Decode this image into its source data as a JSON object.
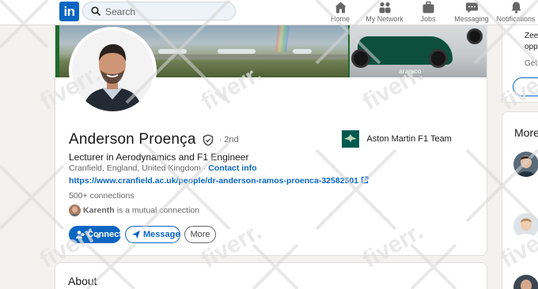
{
  "nav": {
    "logo": "in",
    "search_placeholder": "Search",
    "items": [
      {
        "label": "Home",
        "icon": "home-icon"
      },
      {
        "label": "My Network",
        "icon": "network-icon"
      },
      {
        "label": "Jobs",
        "icon": "briefcase-icon"
      },
      {
        "label": "Messaging",
        "icon": "message-icon"
      },
      {
        "label": "Notifications",
        "icon": "bell-icon"
      }
    ]
  },
  "profile": {
    "name": "Anderson Proença",
    "degree": "· 2nd",
    "headline": "Lecturer in Aerodynamics and F1 Engineer",
    "location": "Cranfield, England, United Kingdom",
    "separator": " · ",
    "contact_info": "Contact info",
    "website": "https://www.cranfield.ac.uk/people/dr-anderson-ramos-proenca-32582501",
    "connections": "500+ connections",
    "mutual_name": "Karenth",
    "mutual_text": " is a mutual connection",
    "company": "Aston Martin F1 Team",
    "cover_car_text": "aramco"
  },
  "actions": {
    "connect": "Connect",
    "message": "Message",
    "more": "More"
  },
  "about": {
    "title": "About"
  },
  "right": {
    "ad_line1": "Zee",
    "ad_line2": "opp",
    "ad_line3": "Get t",
    "more_title": "More"
  },
  "watermark": "fiverr.",
  "colors": {
    "brand": "#0a66c2",
    "page_bg": "#f4f2ee",
    "card_bg": "#ffffff",
    "company_logo": "#00594f"
  }
}
